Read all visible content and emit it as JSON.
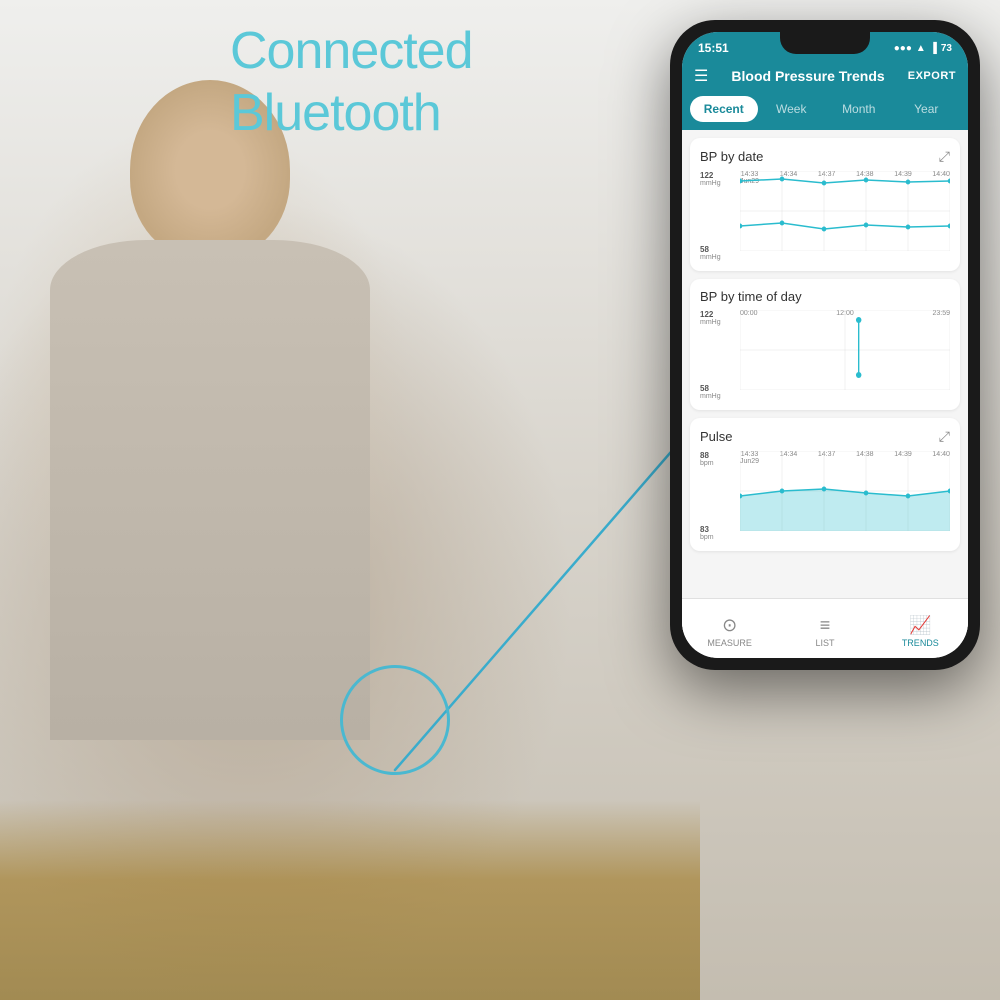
{
  "background": {
    "headline_line1": "Connected",
    "headline_line2": "Bluetooth"
  },
  "phone": {
    "status_bar": {
      "time": "15:51",
      "battery": "73",
      "signal": "●●●",
      "wifi": "wifi"
    },
    "header": {
      "menu_icon": "☰",
      "title": "Blood Pressure Trends",
      "export": "EXPORT"
    },
    "tabs": [
      {
        "label": "Recent",
        "active": true
      },
      {
        "label": "Week",
        "active": false
      },
      {
        "label": "Month",
        "active": false
      },
      {
        "label": "Year",
        "active": false
      }
    ],
    "charts": [
      {
        "title": "BP by date",
        "y_top": "122",
        "y_top_unit": "mmHg",
        "y_bottom": "58",
        "y_bottom_unit": "mmHg",
        "x_labels": [
          "14:33\nJun29",
          "14:34",
          "14:37",
          "14:38",
          "14:39",
          "14:40"
        ],
        "has_expand": true
      },
      {
        "title": "BP by time of day",
        "y_top": "122",
        "y_top_unit": "mmHg",
        "y_bottom": "58",
        "y_bottom_unit": "mmHg",
        "x_labels": [
          "00:00",
          "12:00",
          "23:59"
        ],
        "has_expand": false
      },
      {
        "title": "Pulse",
        "y_top": "88",
        "y_top_unit": "bpm",
        "y_bottom": "83",
        "y_bottom_unit": "bpm",
        "x_labels": [
          "14:33\nJun29",
          "14:34",
          "14:37",
          "14:38",
          "14:39",
          "14:40"
        ],
        "has_expand": true
      }
    ],
    "bottom_nav": [
      {
        "label": "MEASURE",
        "icon": "⊙",
        "active": false
      },
      {
        "label": "LIST",
        "icon": "☰",
        "active": false
      },
      {
        "label": "TRENDS",
        "icon": "📈",
        "active": true
      }
    ]
  }
}
